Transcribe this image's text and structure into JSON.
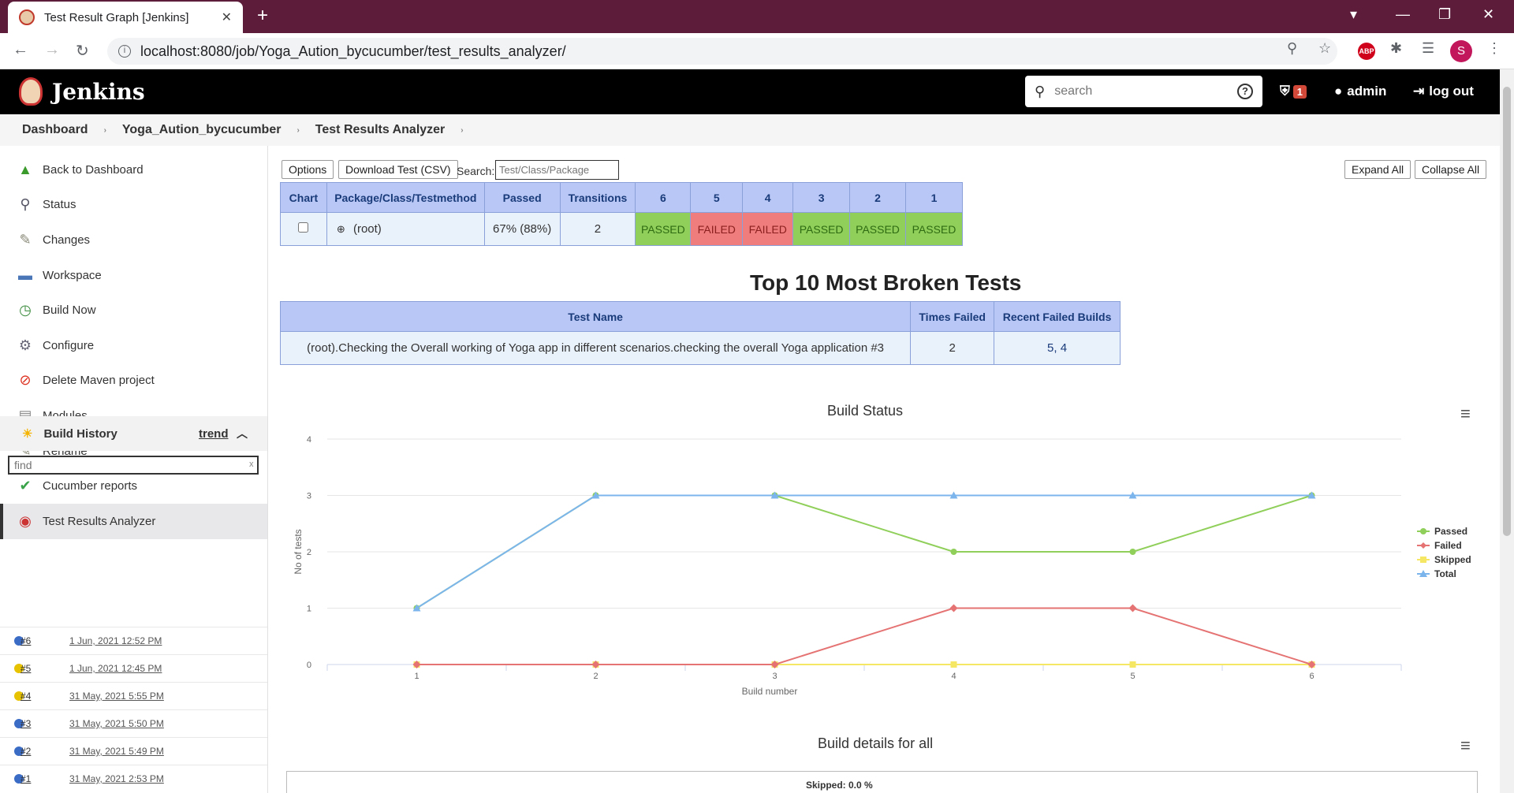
{
  "browser": {
    "tab_title": "Test Result Graph [Jenkins]",
    "url": "localhost:8080/job/Yoga_Aution_bycucumber/test_results_analyzer/",
    "abp_label": "ABP",
    "profile_initial": "S"
  },
  "header": {
    "title": "Jenkins",
    "search_placeholder": "search",
    "alert_count": "1",
    "user": "admin",
    "logout": "log out"
  },
  "breadcrumb": [
    "Dashboard",
    "Yoga_Aution_bycucumber",
    "Test Results Analyzer"
  ],
  "sidebar": {
    "items": [
      {
        "label": "Back to Dashboard",
        "icon": "up-arrow-icon"
      },
      {
        "label": "Status",
        "icon": "magnifier-icon"
      },
      {
        "label": "Changes",
        "icon": "notepad-icon"
      },
      {
        "label": "Workspace",
        "icon": "folder-icon"
      },
      {
        "label": "Build Now",
        "icon": "clock-play-icon"
      },
      {
        "label": "Configure",
        "icon": "gear-icon"
      },
      {
        "label": "Delete Maven project",
        "icon": "no-entry-icon"
      },
      {
        "label": "Modules",
        "icon": "document-icon"
      },
      {
        "label": "Rename",
        "icon": "notepad-icon"
      },
      {
        "label": "Cucumber reports",
        "icon": "cucumber-icon"
      },
      {
        "label": "Test Results Analyzer",
        "icon": "analyzer-icon"
      }
    ],
    "build_history": {
      "title": "Build History",
      "trend": "trend",
      "find_placeholder": "find",
      "clear": "x",
      "builds": [
        {
          "num": "#6",
          "date": "1 Jun, 2021 12:52 PM",
          "status": "blue"
        },
        {
          "num": "#5",
          "date": "1 Jun, 2021 12:45 PM",
          "status": "yellow"
        },
        {
          "num": "#4",
          "date": "31 May, 2021 5:55 PM",
          "status": "yellow"
        },
        {
          "num": "#3",
          "date": "31 May, 2021 5:50 PM",
          "status": "blue"
        },
        {
          "num": "#2",
          "date": "31 May, 2021 5:49 PM",
          "status": "blue"
        },
        {
          "num": "#1",
          "date": "31 May, 2021 2:53 PM",
          "status": "blue"
        }
      ]
    }
  },
  "toolbar": {
    "options": "Options",
    "download": "Download Test (CSV)",
    "search_label": "Search:",
    "search_placeholder": "Test/Class/Package",
    "expand_all": "Expand All",
    "collapse_all": "Collapse All"
  },
  "results_table": {
    "headers": [
      "Chart",
      "Package/Class/Testmethod",
      "Passed",
      "Transitions",
      "6",
      "5",
      "4",
      "3",
      "2",
      "1"
    ],
    "row": {
      "name": "(root)",
      "passed": "67% (88%)",
      "transitions": "2",
      "statuses": [
        "PASSED",
        "FAILED",
        "FAILED",
        "PASSED",
        "PASSED",
        "PASSED"
      ]
    }
  },
  "broken": {
    "title": "Top 10 Most Broken Tests",
    "headers": [
      "Test Name",
      "Times Failed",
      "Recent Failed Builds"
    ],
    "row": {
      "name": "(root).Checking the Overall working of Yoga app in different scenarios.checking the overall Yoga application #3",
      "times_failed": "2",
      "recent": "5, 4"
    }
  },
  "colors": {
    "passed": "#8fcf5a",
    "failed": "#ef7d7d",
    "skipped": "#f5e663",
    "total": "#7cb5ec",
    "header_bg": "#000000",
    "table_header": "#b8c7f5"
  },
  "chart_data": {
    "type": "line",
    "title": "Build Status",
    "xlabel": "Build number",
    "ylabel": "No of tests",
    "x": [
      1,
      2,
      3,
      4,
      5,
      6
    ],
    "ylim": [
      0,
      4
    ],
    "yticks": [
      0,
      1,
      2,
      3,
      4
    ],
    "grid": true,
    "legend_position": "right",
    "series": [
      {
        "name": "Passed",
        "color": "#8fcf5a",
        "values": [
          1,
          3,
          3,
          2,
          2,
          3
        ]
      },
      {
        "name": "Failed",
        "color": "#e57373",
        "values": [
          0,
          0,
          0,
          1,
          1,
          0
        ]
      },
      {
        "name": "Skipped",
        "color": "#f5e663",
        "values": [
          0,
          0,
          0,
          0,
          0,
          0
        ]
      },
      {
        "name": "Total",
        "color": "#7cb5ec",
        "values": [
          1,
          3,
          3,
          3,
          3,
          3
        ]
      }
    ]
  },
  "details": {
    "title": "Build details for all",
    "skipped_label": "Skipped: 0.0 %"
  }
}
